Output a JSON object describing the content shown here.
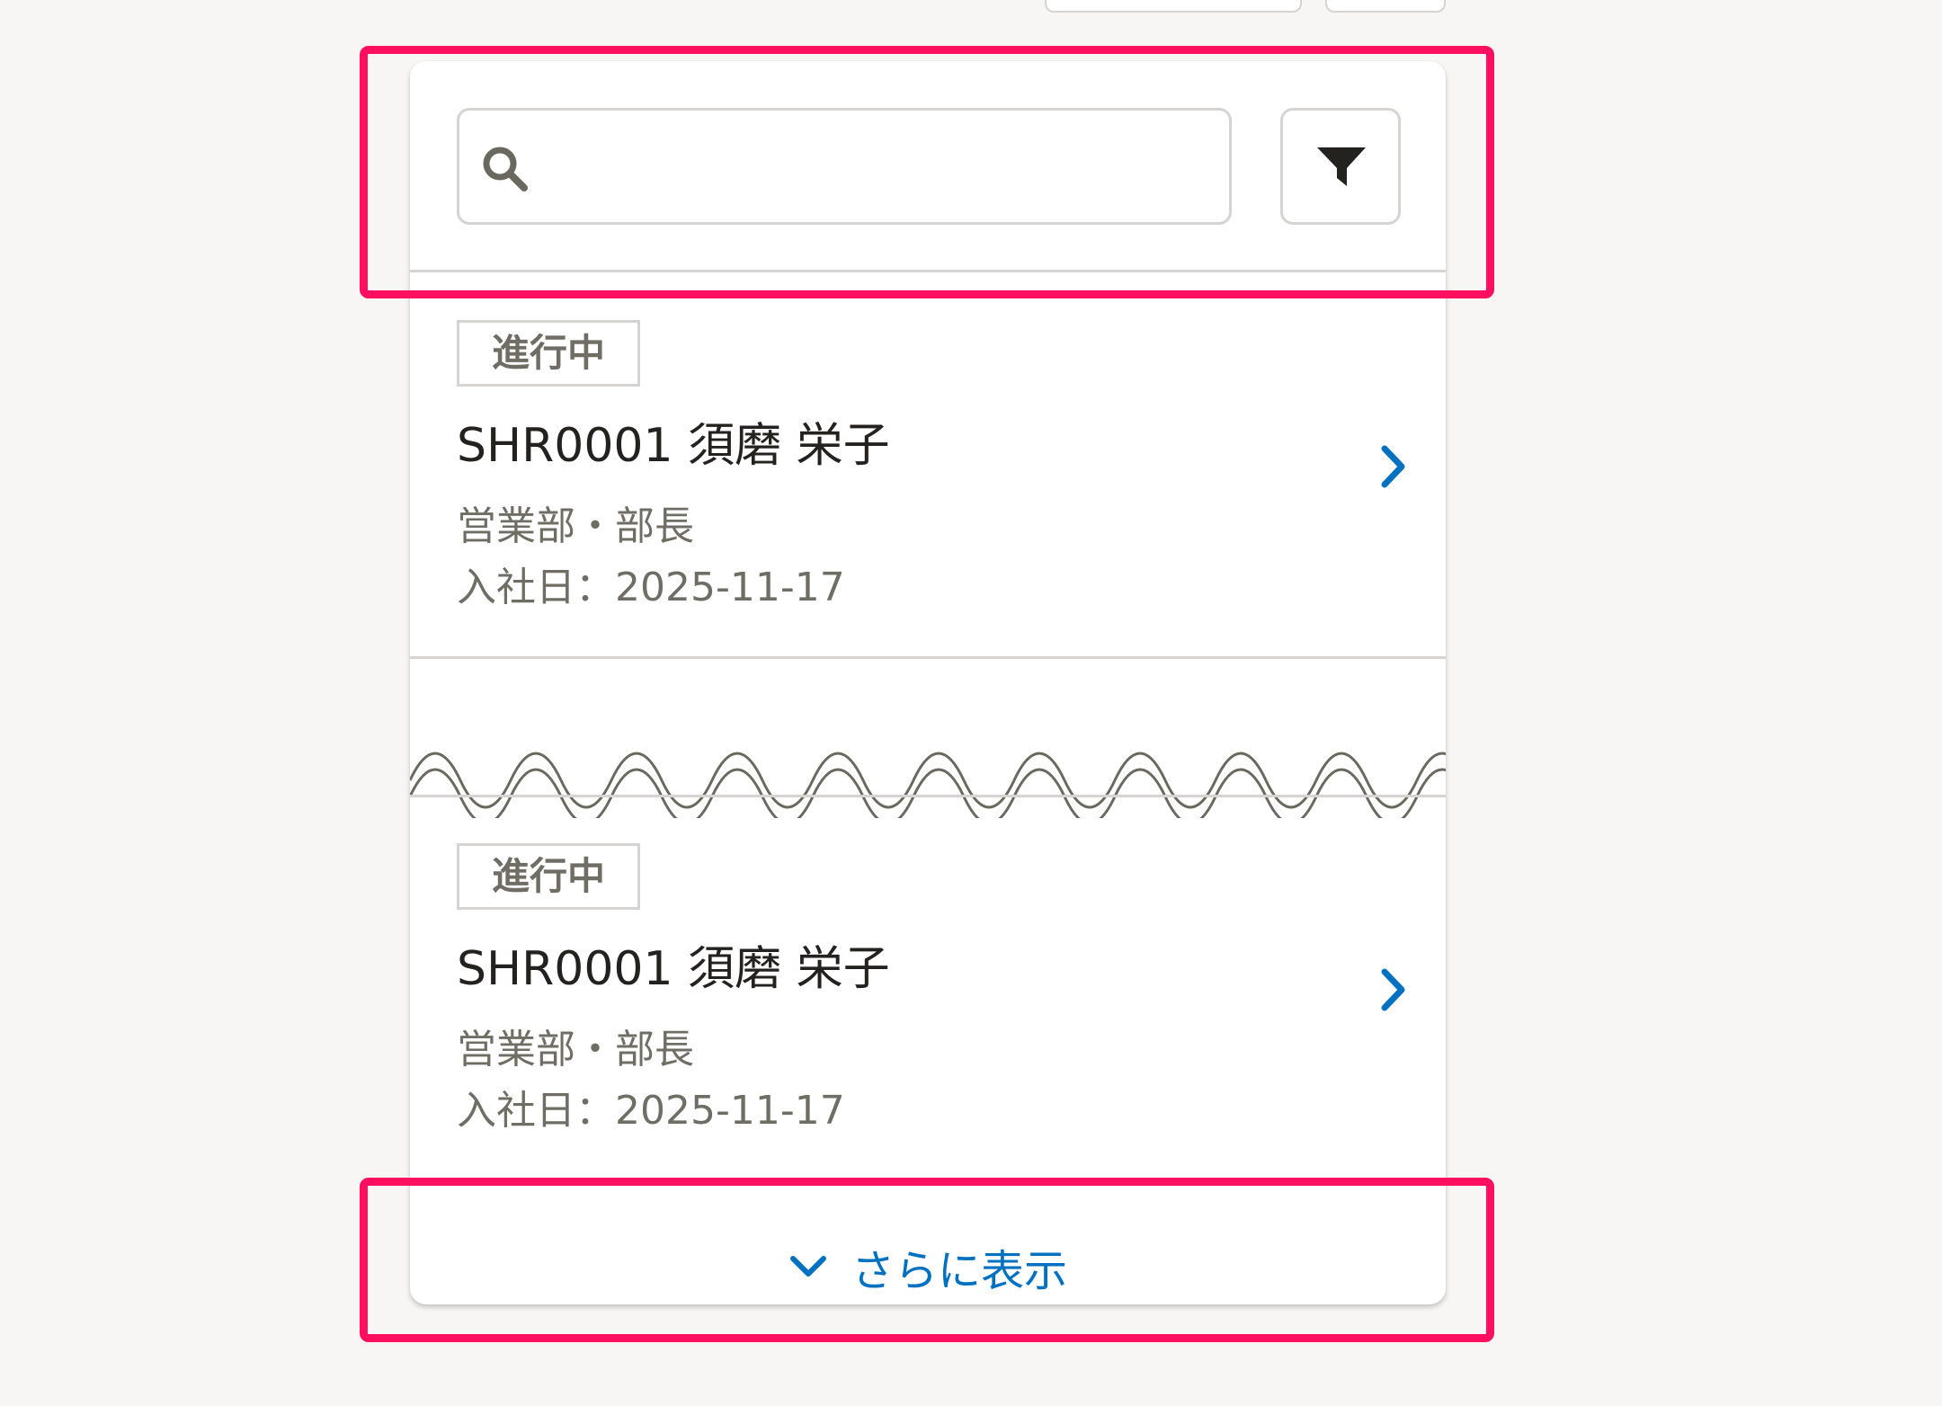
{
  "search": {
    "placeholder": ""
  },
  "employees": [
    {
      "status": "進行中",
      "name": "SHR0001 須磨 栄子",
      "dept": "営業部・部長",
      "joined": "入社日：2025-11-17"
    },
    {
      "status": "進行中",
      "name": "SHR0001 須磨 栄子",
      "dept": "営業部・部長",
      "joined": "入社日：2025-11-17"
    }
  ],
  "show_more_label": "さらに表示",
  "icons": {
    "search": "search-icon",
    "filter": "filter-icon",
    "row_arrow": "chevron-right-icon",
    "more": "chevron-down-icon",
    "separator": "wave-break"
  },
  "colors": {
    "accent": "#0071c1",
    "highlight": "#ff0f5f",
    "border": "#d6d3d0",
    "muted_text": "#706d65",
    "text": "#23221e"
  }
}
